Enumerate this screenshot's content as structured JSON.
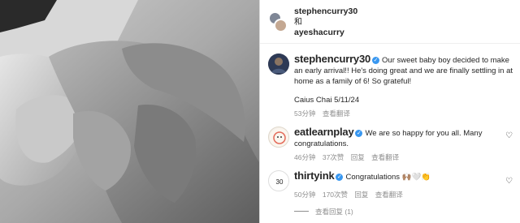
{
  "header": {
    "user1": "stephencurry30",
    "connector": "和",
    "user2": "ayeshacurry"
  },
  "caption": {
    "username": "stephencurry30",
    "text": "Our sweet baby boy decided to make an early arrival!! He's doing great and we are finally settling in at home as a family of 6! So grateful!",
    "credit": "Caius Chai 5/11/24",
    "time": "53分钟",
    "translate": "查看翻译"
  },
  "comments": [
    {
      "username": "eatlearnplay",
      "text": "We are so happy for you all. Many congratulations.",
      "time": "46分钟",
      "likes": "37次赞",
      "reply": "回复",
      "translate": "查看翻译"
    },
    {
      "username": "thirtyink",
      "text": "Congratulations 🙌🏽🤍👏",
      "time": "50分钟",
      "likes": "170次赞",
      "reply": "回复",
      "translate": "查看翻译"
    }
  ],
  "view_replies": "查看回复 (1)",
  "icons": {
    "verified": "verified-badge-icon",
    "heart": "heart-outline-icon"
  },
  "colors": {
    "verified": "#3897f0",
    "meta": "#8e8e8e",
    "text": "#262626"
  }
}
